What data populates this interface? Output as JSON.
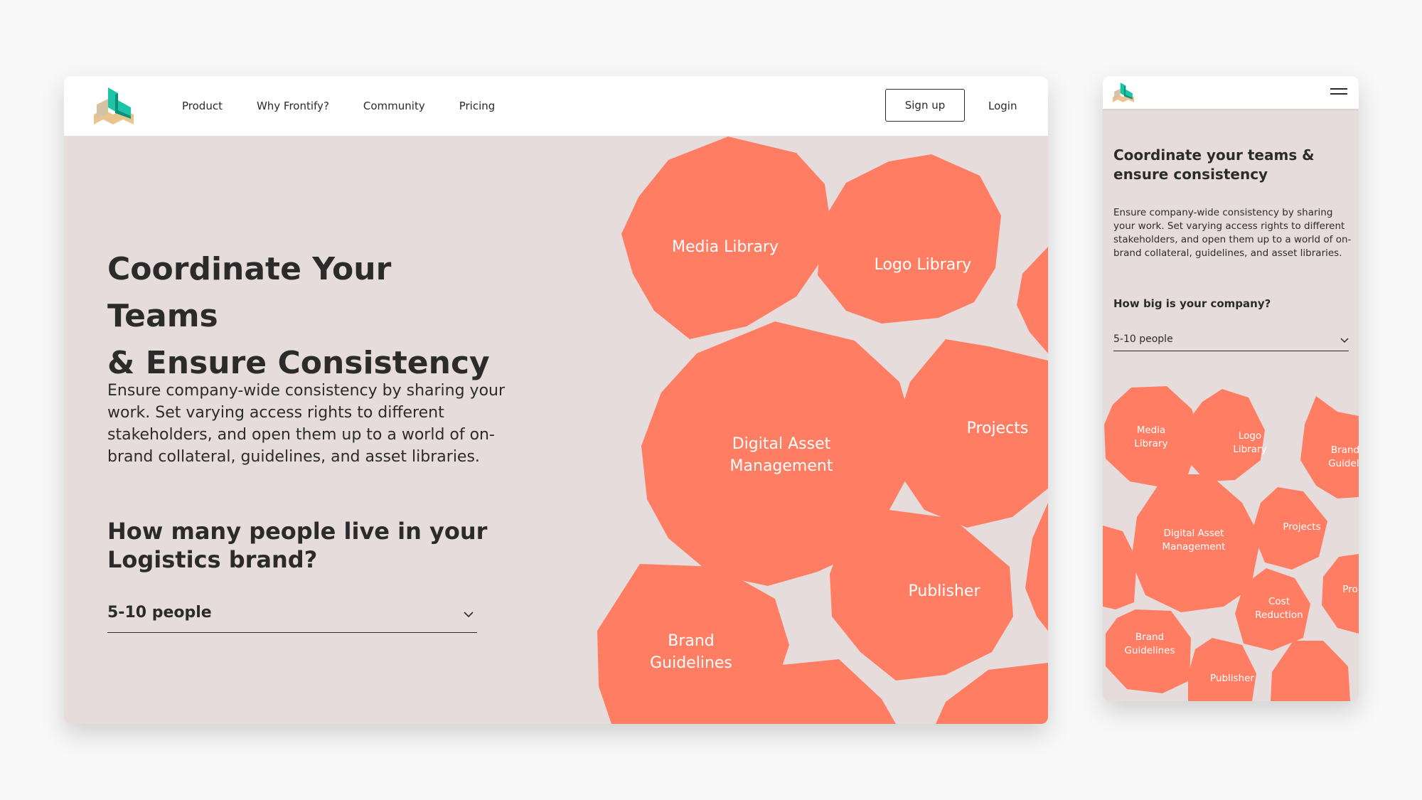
{
  "desktop": {
    "nav": {
      "items": [
        "Product",
        "Why Frontify?",
        "Community",
        "Pricing"
      ],
      "signup": "Sign up",
      "login": "Login"
    },
    "hero": {
      "title_line1": "Coordinate Your Teams",
      "title_line2": "& Ensure Consistency",
      "description": "Ensure company-wide consistency by sharing your work. Set varying access rights to different stakeholders, and open them up to a world of on-brand collateral, guidelines, and asset libraries.",
      "question_line1": "How many people live in your",
      "question_line2": "Logistics brand?",
      "select_value": "5-10 people"
    },
    "tiles": [
      {
        "label1": "Media Library",
        "label2": ""
      },
      {
        "label1": "Logo Library",
        "label2": ""
      },
      {
        "label1": "Digital Asset",
        "label2": "Management"
      },
      {
        "label1": "Projects",
        "label2": ""
      },
      {
        "label1": "Publisher",
        "label2": ""
      },
      {
        "label1": "Brand",
        "label2": "Guidelines"
      }
    ]
  },
  "mobile": {
    "title_line1": "Coordinate your teams &",
    "title_line2": "ensure consistency",
    "description": "Ensure company-wide consistency by sharing your work. Set varying access rights to different stakeholders, and open them up to a world of on-brand collateral, guidelines, and asset libraries.",
    "question": "How big is your company?",
    "select_value": "5-10 people",
    "tiles": [
      {
        "label1": "Media",
        "label2": "Library"
      },
      {
        "label1": "Logo",
        "label2": "Library"
      },
      {
        "label1": "Brand",
        "label2": "Guidelin"
      },
      {
        "label1": "Digital Asset",
        "label2": "Management"
      },
      {
        "label1": "Projects",
        "label2": ""
      },
      {
        "label1": "Cost",
        "label2": "Reduction"
      },
      {
        "label1": "Pro",
        "label2": ""
      },
      {
        "label1": "Brand",
        "label2": "Guidelines"
      },
      {
        "label1": "Publisher",
        "label2": ""
      }
    ]
  },
  "colors": {
    "tile": "#ff7e63",
    "background": "#e7dcdc",
    "text": "#2b2b2b",
    "logo_teal": "#1cc4a5",
    "logo_dark_teal": "#0d8f7a",
    "logo_sand": "#e8c58c",
    "logo_beige": "#d6c3a5"
  },
  "icons": {
    "logo": "frontify-logo-icon",
    "select_arrow": "chevron-down-icon",
    "menu": "hamburger-menu-icon"
  }
}
